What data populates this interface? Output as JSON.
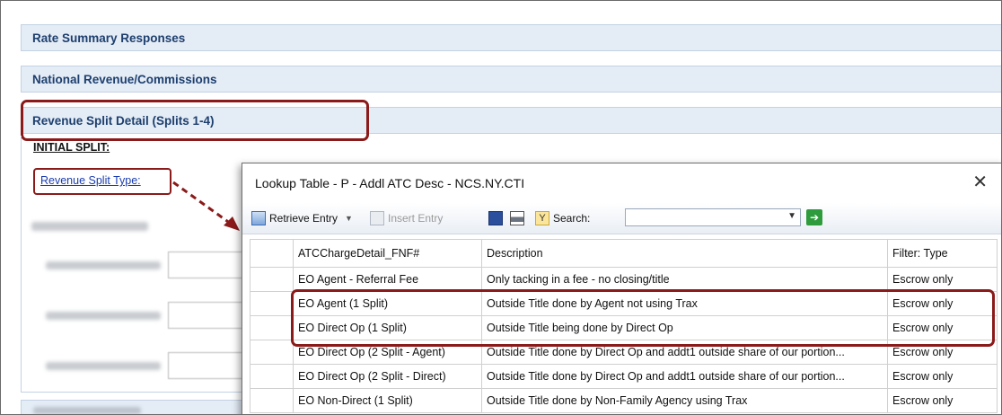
{
  "panels": {
    "rate_summary": "Rate Summary Responses",
    "national_revenue": "National Revenue/Commissions",
    "revenue_split_detail": "Revenue Split Detail (Splits 1-4)"
  },
  "initial_split_label": "INITIAL SPLIT:",
  "revenue_split_type_link": "Revenue Split Type:",
  "dialog": {
    "title": "Lookup Table - P - Addl ATC Desc - NCS.NY.CTI",
    "close": "✕",
    "toolbar": {
      "retrieve_entry": "Retrieve Entry",
      "insert_entry": "Insert Entry",
      "search_label": "Search:",
      "search_value": ""
    },
    "columns": [
      "ATCChargeDetail_FNF#",
      "Description",
      "Filter: Type"
    ],
    "rows": [
      [
        "EO Agent - Referral Fee",
        "Only tacking in a fee - no closing/title",
        "Escrow only"
      ],
      [
        "EO Agent (1 Split)",
        "Outside Title done by Agent not using Trax",
        "Escrow only"
      ],
      [
        "EO Direct Op (1 Split)",
        "Outside Title being done by Direct Op",
        "Escrow only"
      ],
      [
        "EO Direct Op (2 Split - Agent)",
        "Outside Title done by Direct Op and addt1 outside share of our portion...",
        "Escrow only"
      ],
      [
        "EO Direct Op (2 Split - Direct)",
        "Outside Title done by Direct Op and addt1 outside share of our portion...",
        "Escrow only"
      ],
      [
        "EO Non-Direct (1 Split)",
        "Outside Title done by Non-Family Agency using Trax",
        "Escrow only"
      ]
    ]
  },
  "colors": {
    "highlight": "#8b1a1a",
    "panel_bg": "#e4ecf6",
    "panel_text": "#1d3f6e",
    "link": "#1a3cb0"
  }
}
